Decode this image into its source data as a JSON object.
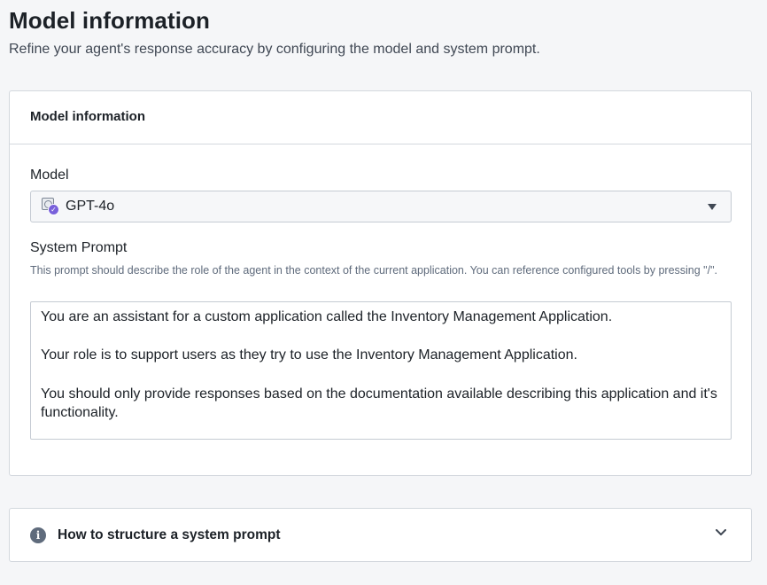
{
  "header": {
    "title": "Model information",
    "subtitle": "Refine your agent's response accuracy by configuring the model and system prompt."
  },
  "card": {
    "title": "Model information",
    "model": {
      "label": "Model",
      "selected": "GPT-4o",
      "icon": "model-chip-icon"
    },
    "system_prompt": {
      "label": "System Prompt",
      "helper": "This prompt should describe the role of the agent in the context of the current application. You can reference configured tools by pressing \"/\".",
      "paragraphs": [
        "You are an assistant for a custom application called the Inventory Management Application.",
        "Your role is to support users as they try to use the Inventory Management Application.",
        "You should only provide responses based on the documentation available describing this application and it's functionality."
      ]
    }
  },
  "help_section": {
    "title": "How to structure a system prompt",
    "icon": "info-icon",
    "expanded": false
  }
}
